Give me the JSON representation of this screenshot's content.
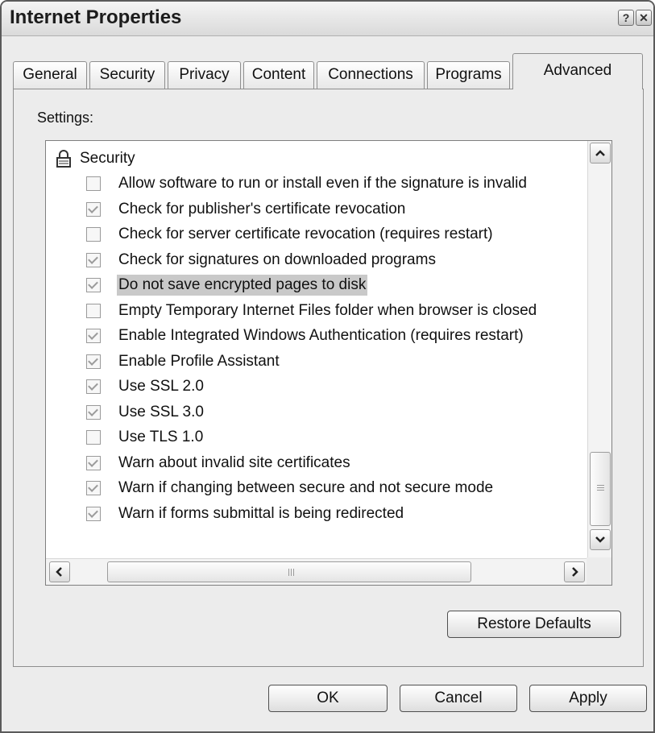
{
  "window": {
    "title": "Internet Properties"
  },
  "tabs": [
    {
      "label": "General"
    },
    {
      "label": "Security"
    },
    {
      "label": "Privacy"
    },
    {
      "label": "Content"
    },
    {
      "label": "Connections"
    },
    {
      "label": "Programs"
    },
    {
      "label": "Advanced"
    }
  ],
  "active_tab": "Advanced",
  "settings": {
    "label": "Settings:",
    "group": {
      "label": "Security",
      "icon": "lock-icon"
    },
    "items": [
      {
        "label": "Allow software to run or install even if the signature is invalid",
        "checked": false
      },
      {
        "label": "Check for publisher's certificate revocation",
        "checked": true
      },
      {
        "label": "Check for server certificate revocation (requires restart)",
        "checked": false
      },
      {
        "label": "Check for signatures on downloaded programs",
        "checked": true
      },
      {
        "label": "Do not save encrypted pages to disk",
        "checked": true,
        "highlighted": true
      },
      {
        "label": "Empty Temporary Internet Files folder when browser is closed",
        "checked": false
      },
      {
        "label": "Enable Integrated Windows Authentication (requires restart)",
        "checked": true
      },
      {
        "label": "Enable Profile Assistant",
        "checked": true
      },
      {
        "label": "Use SSL 2.0",
        "checked": true
      },
      {
        "label": "Use SSL 3.0",
        "checked": true
      },
      {
        "label": "Use TLS 1.0",
        "checked": false
      },
      {
        "label": "Warn about invalid site certificates",
        "checked": true
      },
      {
        "label": "Warn if changing between secure and not secure mode",
        "checked": true
      },
      {
        "label": "Warn if forms submittal is being redirected",
        "checked": true
      }
    ]
  },
  "buttons": {
    "restore_defaults": "Restore Defaults",
    "ok": "OK",
    "cancel": "Cancel",
    "apply": "Apply"
  },
  "colors": {
    "highlight": "#c9c9c9",
    "dialog_bg": "#ececec"
  }
}
